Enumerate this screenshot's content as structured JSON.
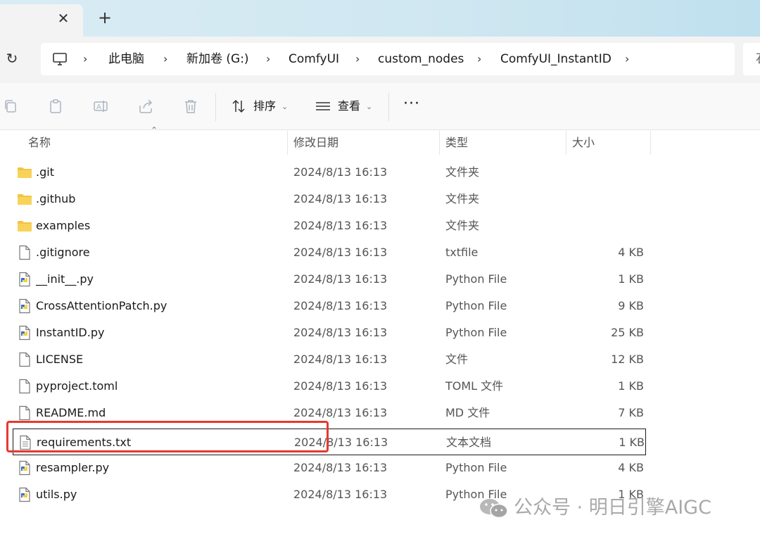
{
  "tabs": {
    "close_glyph": "✕",
    "new_tab_glyph": "+"
  },
  "nav": {
    "refresh_glyph": "↻",
    "breadcrumbs": [
      "此电脑",
      "新加卷 (G:)",
      "ComfyUI",
      "custom_nodes",
      "ComfyUI_InstantID"
    ],
    "separator": "›",
    "search_partial": "石"
  },
  "toolbar": {
    "icons": [
      "copy-icon",
      "paste-icon",
      "rename-icon",
      "share-icon",
      "delete-icon"
    ],
    "sort_label": "排序",
    "view_label": "查看",
    "more_label": "···"
  },
  "columns": {
    "name": "名称",
    "date": "修改日期",
    "type": "类型",
    "size": "大小"
  },
  "files": [
    {
      "name": ".git",
      "date": "2024/8/13 16:13",
      "type": "文件夹",
      "size": "",
      "icon": "folder-icon"
    },
    {
      "name": ".github",
      "date": "2024/8/13 16:13",
      "type": "文件夹",
      "size": "",
      "icon": "folder-icon"
    },
    {
      "name": "examples",
      "date": "2024/8/13 16:13",
      "type": "文件夹",
      "size": "",
      "icon": "folder-icon"
    },
    {
      "name": ".gitignore",
      "date": "2024/8/13 16:13",
      "type": "txtfile",
      "size": "4 KB",
      "icon": "file-icon"
    },
    {
      "name": "__init__.py",
      "date": "2024/8/13 16:13",
      "type": "Python File",
      "size": "1 KB",
      "icon": "python-file-icon"
    },
    {
      "name": "CrossAttentionPatch.py",
      "date": "2024/8/13 16:13",
      "type": "Python File",
      "size": "9 KB",
      "icon": "python-file-icon"
    },
    {
      "name": "InstantID.py",
      "date": "2024/8/13 16:13",
      "type": "Python File",
      "size": "25 KB",
      "icon": "python-file-icon"
    },
    {
      "name": "LICENSE",
      "date": "2024/8/13 16:13",
      "type": "文件",
      "size": "12 KB",
      "icon": "file-icon"
    },
    {
      "name": "pyproject.toml",
      "date": "2024/8/13 16:13",
      "type": "TOML 文件",
      "size": "1 KB",
      "icon": "file-icon"
    },
    {
      "name": "README.md",
      "date": "2024/8/13 16:13",
      "type": "MD 文件",
      "size": "7 KB",
      "icon": "file-icon"
    },
    {
      "name": "requirements.txt",
      "date": "2024/8/13 16:13",
      "type": "文本文档",
      "size": "1 KB",
      "icon": "text-document-icon",
      "selected": true
    },
    {
      "name": "resampler.py",
      "date": "2024/8/13 16:13",
      "type": "Python File",
      "size": "4 KB",
      "icon": "python-file-icon"
    },
    {
      "name": "utils.py",
      "date": "2024/8/13 16:13",
      "type": "Python File",
      "size": "1 KB",
      "icon": "python-file-icon"
    }
  ],
  "watermark": {
    "text": "公众号 · 明日引擎AIGC"
  },
  "colors": {
    "highlight": "#e53a2f",
    "folder": "#f5c342",
    "python_blue": "#3b73b9",
    "python_yellow": "#f7cf3c"
  }
}
